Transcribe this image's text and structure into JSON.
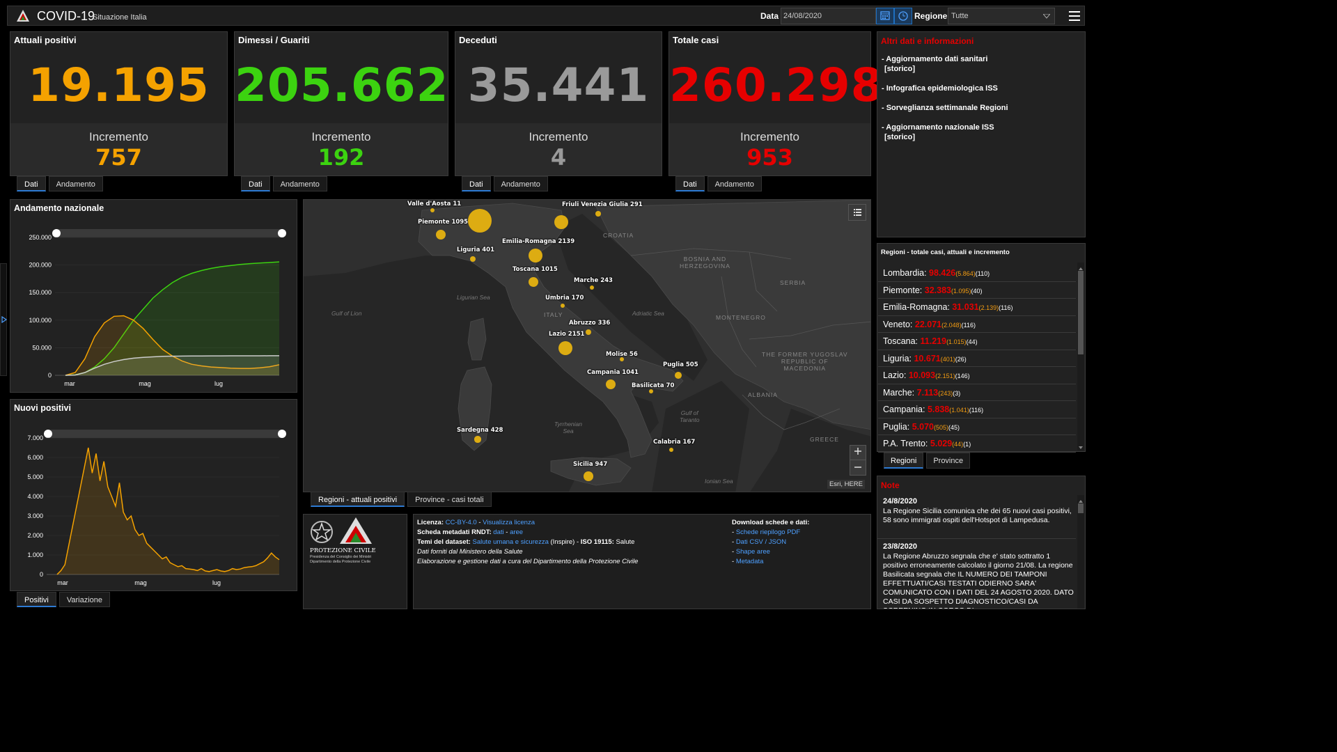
{
  "header": {
    "title": "COVID-19",
    "subtitle": "Situazione Italia",
    "date_label": "Data",
    "date_value": "24/08/2020",
    "region_label": "Regione",
    "region_value": "Tutte"
  },
  "kpis": [
    {
      "title": "Attuali positivi",
      "value": "19.195",
      "inc_label": "Incremento",
      "inc_value": "757",
      "color": "#f5a200"
    },
    {
      "title": "Dimessi / Guariti",
      "value": "205.662",
      "inc_label": "Incremento",
      "inc_value": "192",
      "color": "#3cd310"
    },
    {
      "title": "Deceduti",
      "value": "35.441",
      "inc_label": "Incremento",
      "inc_value": "4",
      "color": "#9a9a9a"
    },
    {
      "title": "Totale casi",
      "value": "260.298",
      "inc_label": "Incremento",
      "inc_value": "953",
      "color": "#e60000"
    }
  ],
  "kpi_tabs": {
    "dati": "Dati",
    "andamento": "Andamento"
  },
  "info": {
    "title": "Altri dati e informazioni",
    "links": [
      {
        "line1": "- Aggiornamento dati sanitari",
        "line2": "[storico]"
      },
      {
        "line1": "- Infografica epidemiologica ISS",
        "line2": ""
      },
      {
        "line1": "- Sorveglianza settimanale Regioni",
        "line2": ""
      },
      {
        "line1": "- Aggiornamento nazionale ISS",
        "line2": "[storico]"
      }
    ]
  },
  "regions_panel": {
    "title": "Regioni - totale casi, attuali e incremento",
    "rows": [
      {
        "name": "Lombardia:",
        "total": "98.426",
        "active": "(5.864)",
        "inc": "(110)"
      },
      {
        "name": "Piemonte:",
        "total": "32.383",
        "active": "(1.095)",
        "inc": "(40)"
      },
      {
        "name": "Emilia-Romagna:",
        "total": "31.031",
        "active": "(2.139)",
        "inc": "(116)"
      },
      {
        "name": "Veneto:",
        "total": "22.071",
        "active": "(2.048)",
        "inc": "(116)"
      },
      {
        "name": "Toscana:",
        "total": "11.219",
        "active": "(1.015)",
        "inc": "(44)"
      },
      {
        "name": "Liguria:",
        "total": "10.671",
        "active": "(401)",
        "inc": "(26)"
      },
      {
        "name": "Lazio:",
        "total": "10.093",
        "active": "(2.151)",
        "inc": "(146)"
      },
      {
        "name": "Marche:",
        "total": "7.113",
        "active": "(243)",
        "inc": "(3)"
      },
      {
        "name": "Campania:",
        "total": "5.838",
        "active": "(1.041)",
        "inc": "(116)"
      },
      {
        "name": "Puglia:",
        "total": "5.070",
        "active": "(505)",
        "inc": "(45)"
      },
      {
        "name": "P.A. Trento:",
        "total": "5.029",
        "active": "(44)",
        "inc": "(1)"
      }
    ],
    "tab_regioni": "Regioni",
    "tab_province": "Province"
  },
  "notes": {
    "title": "Note",
    "items": [
      {
        "date": "24/8/2020",
        "text": "La Regione Sicilia comunica che dei 65 nuovi casi positivi, 58 sono immigrati ospiti dell'Hotspot di Lampedusa."
      },
      {
        "date": "23/8/2020",
        "text": "La Regione Abruzzo segnala che e' stato sottratto 1 positivo erroneamente calcolato il giorno 21/08. La regione Basilicata segnala che IL NUMERO DEI TAMPONI EFFETTUATI/CASI TESTATI ODIERNO SARA' COMUNICATO CON I DATI DEL 24 AGOSTO 2020. DATO CASI DA SOSPETTO DIAGNOSTICO/CASI DA SCREENING IN CORSO DI"
      }
    ]
  },
  "map": {
    "points": [
      {
        "label": "Valle d'Aosta 11",
        "value": 11
      },
      {
        "label": "Piemonte 1095",
        "value": 1095
      },
      {
        "label": "Lombardia",
        "value": 5864
      },
      {
        "label": "Veneto",
        "value": 2048
      },
      {
        "label": "Friuli Venezia Giulia 291",
        "value": 291
      },
      {
        "label": "Liguria 401",
        "value": 401
      },
      {
        "label": "Emilia-Romagna 2139",
        "value": 2139
      },
      {
        "label": "Toscana 1015",
        "value": 1015
      },
      {
        "label": "Marche 243",
        "value": 243
      },
      {
        "label": "Umbria 170",
        "value": 170
      },
      {
        "label": "Abruzzo 336",
        "value": 336
      },
      {
        "label": "Lazio 2151",
        "value": 2151
      },
      {
        "label": "Molise 56",
        "value": 56
      },
      {
        "label": "Puglia 505",
        "value": 505
      },
      {
        "label": "Campania 1041",
        "value": 1041
      },
      {
        "label": "Basilicata 70",
        "value": 70
      },
      {
        "label": "Sardegna 428",
        "value": 428
      },
      {
        "label": "Calabria 167",
        "value": 167
      },
      {
        "label": "Sicilia 947",
        "value": 947
      }
    ],
    "geo_labels": {
      "croatia": "CROATIA",
      "bosnia1": "BOSNIA AND",
      "bosnia2": "HERZEGOVINA",
      "serbia": "SERBIA",
      "montenegro": "MONTENEGRO",
      "fyrom1": "THE FORMER YUGOSLAV",
      "fyrom2": "REPUBLIC OF",
      "fyrom3": "MACEDONIA",
      "albania": "ALBANIA",
      "greece": "GREECE",
      "italy": "ITALY"
    },
    "sea_labels": {
      "ligurian": "Ligurian Sea",
      "lion": "Gulf of Lion",
      "adriatic": "Adriatic Sea",
      "tyrr1": "Tyrrhenian",
      "tyrr2": "Sea",
      "taranto1": "Gulf of",
      "taranto2": "Taranto",
      "ionian": "Ionian Sea"
    },
    "attribution": "Esri, HERE",
    "tab_regioni": "Regioni - attuali positivi",
    "tab_province": "Province - casi totali"
  },
  "footer": {
    "org1": "PROTEZIONE CIVILE",
    "org2": "Presidenza del Consiglio dei Ministri",
    "org3": "Dipartimento della Protezione Civile",
    "licenza_label": "Licenza:",
    "licenza_value": "CC-BY-4.0",
    "licenza_sep": " - ",
    "licenza_link": "Visualizza licenza",
    "scheda_label": "Scheda metadati RNDT:",
    "scheda_dati": "dati",
    "scheda_sep": " - ",
    "scheda_aree": "aree",
    "temi_label": "Temi del dataset:",
    "temi_link": "Salute umana e sicurezza",
    "temi_rest": " (Inspire) - ",
    "iso_label": "ISO 19115:",
    "iso_value": " Salute",
    "line4": "Dati forniti dal Ministero della Salute",
    "line5": "Elaborazione e gestione dati a cura del Dipartimento della Protezione Civile",
    "download_title": "Download schede e dati:",
    "download_links": [
      "Schede riepilogo PDF",
      "Dati CSV / JSON",
      "Shape aree",
      "Metadata"
    ]
  },
  "chart_data": [
    {
      "type": "line",
      "title": "Andamento nazionale",
      "x_ticks": [
        "mar",
        "mag",
        "lug"
      ],
      "y_ticks": [
        "250.000",
        "200.000",
        "150.000",
        "100.000",
        "50.000",
        "0"
      ],
      "ylim": [
        0,
        250000
      ],
      "series": [
        {
          "color": "#3cd310",
          "values": [
            0,
            1000,
            5000,
            15000,
            30000,
            50000,
            75000,
            100000,
            120000,
            140000,
            155000,
            168000,
            178000,
            185000,
            190000,
            194000,
            197000,
            199000,
            201000,
            202500,
            203500,
            204500,
            205662
          ]
        },
        {
          "color": "#f5a200",
          "values": [
            0,
            5000,
            30000,
            70000,
            95000,
            107000,
            108000,
            100000,
            85000,
            65000,
            47000,
            35000,
            26000,
            20000,
            17000,
            15000,
            14000,
            13000,
            12500,
            12500,
            13500,
            15500,
            19195
          ]
        },
        {
          "color": "#cccccc",
          "values": [
            0,
            500,
            5000,
            13000,
            20000,
            25000,
            28500,
            31000,
            32500,
            33500,
            34300,
            34700,
            34900,
            35000,
            35100,
            35200,
            35250,
            35300,
            35350,
            35380,
            35410,
            35430,
            35441
          ]
        }
      ]
    },
    {
      "type": "line",
      "title": "Nuovi positivi",
      "x_ticks": [
        "mar",
        "mag",
        "lug"
      ],
      "y_ticks": [
        "7.000",
        "6.000",
        "5.000",
        "4.000",
        "3.000",
        "2.000",
        "1.000",
        "0"
      ],
      "ylim": [
        0,
        7000
      ],
      "series": [
        {
          "color": "#f5a200",
          "values": [
            0,
            200,
            500,
            1500,
            2500,
            3500,
            4500,
            5500,
            6500,
            5200,
            6200,
            4800,
            5800,
            4500,
            4000,
            3500,
            4700,
            3200,
            2800,
            3000,
            2300,
            2000,
            2100,
            1600,
            1400,
            1200,
            1000,
            800,
            900,
            600,
            500,
            400,
            450,
            300,
            280,
            250,
            200,
            300,
            180,
            150,
            200,
            250,
            180,
            150,
            200,
            300,
            250,
            280,
            350,
            380,
            400,
            450,
            550,
            650,
            850,
            1100,
            900,
            757
          ]
        }
      ]
    }
  ],
  "chart_tabs": {
    "positivi": "Positivi",
    "variazione": "Variazione"
  }
}
